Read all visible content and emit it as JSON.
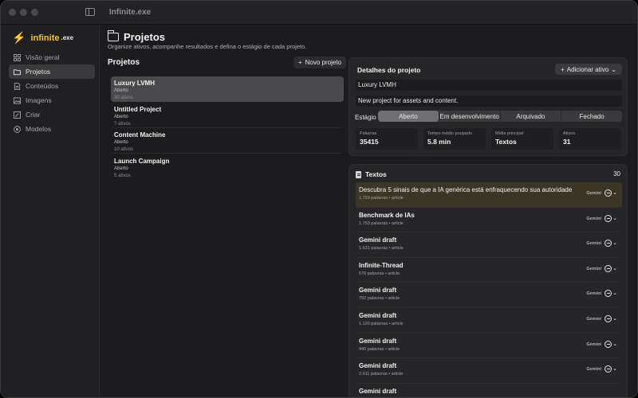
{
  "app": {
    "title": "Infinite.exe",
    "logo_main": "infinite",
    "logo_ext": ".exe"
  },
  "sidebar": {
    "items": [
      {
        "label": "Visão geral",
        "icon": "grid-icon"
      },
      {
        "label": "Projetos",
        "icon": "folder-icon",
        "active": true
      },
      {
        "label": "Conteúdos",
        "icon": "document-icon"
      },
      {
        "label": "Imagens",
        "icon": "image-icon"
      },
      {
        "label": "Criar",
        "icon": "create-icon"
      },
      {
        "label": "Modelos",
        "icon": "models-icon"
      }
    ]
  },
  "page": {
    "title": "Projetos",
    "subtitle": "Organize ativos, acompanhe resultados e defina o estágio de cada projeto."
  },
  "projects": {
    "heading": "Projetos",
    "new_button": "Novo projeto",
    "items": [
      {
        "name": "Luxury LVMH",
        "stage": "Aberto",
        "count": "30 ativos",
        "selected": true
      },
      {
        "name": "Untitled Project",
        "stage": "Aberto",
        "count": "7 ativos"
      },
      {
        "name": "Content Machine",
        "stage": "Aberto",
        "count": "10 ativos"
      },
      {
        "name": "Launch Campaign",
        "stage": "Aberto",
        "count": "5 ativos"
      }
    ]
  },
  "details": {
    "title": "Detalhes do projeto",
    "add_button": "Adicionar ativo",
    "name_value": "Luxury LVMH",
    "description_value": "New project for assets and content.",
    "stage_label": "Estágio",
    "stages": [
      "Aberto",
      "Em desenvolvimento",
      "Arquivado",
      "Fechado"
    ],
    "active_stage": "Aberto",
    "stats": [
      {
        "label": "Palavras",
        "value": "35415"
      },
      {
        "label": "Tempo médio poupado",
        "value": "5.8 min"
      },
      {
        "label": "Mídia principal",
        "value": "Textos"
      },
      {
        "label": "Ativos",
        "value": "31"
      }
    ]
  },
  "textos": {
    "title": "Textos",
    "count": "30",
    "items": [
      {
        "title": "Descubra 5 sinais de que a IA genérica está enfraquecendo sua autoridade",
        "meta": "1.729 palavras • article",
        "model": "Gemini",
        "highlight": true
      },
      {
        "title": "Benchmark de IAs",
        "meta": "1.753 palavras • article",
        "model": "Gemini"
      },
      {
        "title": "Gemini draft",
        "meta": "1.631 palavras • article",
        "model": "Gemini"
      },
      {
        "title": "Infinite-Thread",
        "meta": "576 palavras • article",
        "model": "Gemini"
      },
      {
        "title": "Gemini draft",
        "meta": "792 palavras • article",
        "model": "Gemini"
      },
      {
        "title": "Gemini draft",
        "meta": "1.120 palavras • article",
        "model": "Gemini"
      },
      {
        "title": "Gemini draft",
        "meta": "440 palavras • article",
        "model": "Gemini"
      },
      {
        "title": "Gemini draft",
        "meta": "2.911 palavras • article",
        "model": "Gemini"
      },
      {
        "title": "Gemini draft",
        "meta": "",
        "model": ""
      }
    ]
  },
  "colors": {
    "accent": "#f5c518",
    "background": "#1c1c1e",
    "highlight_row": "#3b3624"
  }
}
